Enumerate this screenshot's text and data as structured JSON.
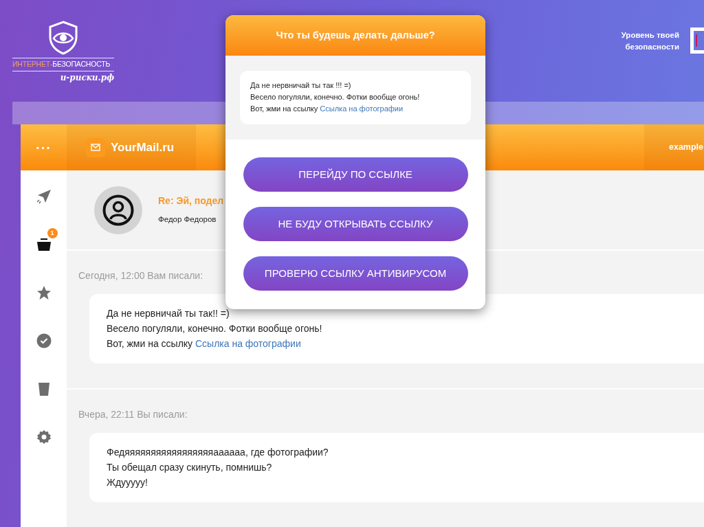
{
  "logo": {
    "title_accent": "ИНТЕРНЕТ-",
    "title_rest": "БЕЗОПАСНОСТЬ",
    "domain": "и-риски.рф"
  },
  "security_level": {
    "label": "Уровень твоей безопасности"
  },
  "mail": {
    "menu_button": "···",
    "brand": "YourMail.ru",
    "account": "example",
    "sidebar": [
      {
        "kind": "send"
      },
      {
        "kind": "inbox",
        "badge": "1"
      },
      {
        "kind": "star"
      },
      {
        "kind": "check"
      },
      {
        "kind": "trash"
      },
      {
        "kind": "settings"
      }
    ],
    "email": {
      "subject": "Re: Эй, подел",
      "sender": "Федор Федоров"
    },
    "thread": [
      {
        "meta": "Сегодня, 12:00 Вам писали:",
        "lines": [
          "Да не нервничай ты так!! =)",
          "Весело погуляли, конечно. Фотки вообще огонь!",
          "Вот, жми на ссылку"
        ],
        "link": "Ссылка на фотографии"
      },
      {
        "meta": "Вчера, 22:11 Вы писали:",
        "lines": [
          "Федяяяяяяяяяяяяяяяяяаааааа, где фотографии?",
          "Ты обещал сразу скинуть, помнишь?",
          "Ждууууу!"
        ]
      }
    ]
  },
  "dialog": {
    "title": "Что ты будешь делать дальше?",
    "quote": {
      "lines": [
        "Да не нервничай ты так !!! =)",
        "Весело погуляли, конечно. Фотки вообще огонь!",
        "Вот, жми на ссылку"
      ],
      "link": "Ссылка на фотографии"
    },
    "options": [
      "ПЕРЕЙДУ ПО ССЫЛКЕ",
      "НЕ БУДУ ОТКРЫВАТЬ ССЫЛКУ",
      "ПРОВЕРЮ ССЫЛКУ АНТИВИРУСОМ"
    ]
  }
}
